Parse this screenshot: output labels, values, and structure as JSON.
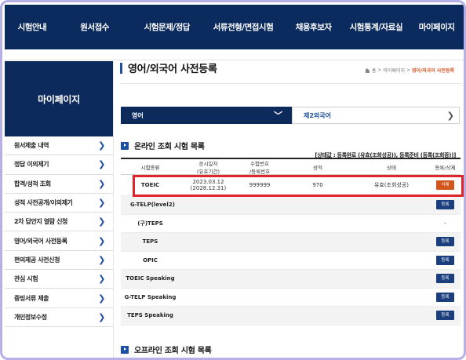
{
  "topnav": {
    "items": [
      "시험안내",
      "원서접수",
      "시험문제/정답",
      "서류전형/면접시험",
      "채용후보자",
      "시험통계/자료실",
      "마이페이지"
    ]
  },
  "sidebar": {
    "banner": "마이페이지",
    "items": [
      {
        "label": "원서제출 내역"
      },
      {
        "label": "정답 이의제기"
      },
      {
        "label": "합격/성적 조회"
      },
      {
        "label": "성적 사전공개/이의제기"
      },
      {
        "label": "2차 답안지 열람 신청"
      },
      {
        "label": "영어/외국어 사전등록"
      },
      {
        "label": "편의제공 사전신청"
      },
      {
        "label": "관심 시험"
      },
      {
        "label": "증빙서류 제출"
      },
      {
        "label": "개인정보수정"
      }
    ]
  },
  "page": {
    "title": "영어/외국어 사전등록",
    "breadcrumb": {
      "home": "홈",
      "sep1": ">",
      "level1": "마이페이지",
      "sep2": ">",
      "current": "영어/외국어 사전등록"
    }
  },
  "tabs": {
    "active": "영어",
    "inactive": "제2외국어"
  },
  "online_section": {
    "title": "온라인 조회 시험 목록",
    "legend": "[상태값 : 등록완료 (유효(조회성공)), 등록준비 (등록(조회중))]",
    "headers": {
      "exam": "시험종류",
      "date_line1": "응시일자",
      "date_line2": "(유효기간)",
      "num_line1": "수험번호",
      "num_line2": "/등록번호",
      "score": "성적",
      "status": "상태",
      "action": "등록/삭제"
    },
    "rows": [
      {
        "exam": "TOEIC",
        "date": "2023.03.12",
        "valid": "(2028.12.31)",
        "number": "999999",
        "score": "970",
        "status": "유효(조회성공)",
        "action": "삭제"
      },
      {
        "exam": "G-TELP(level2)",
        "date": "",
        "valid": "",
        "number": "",
        "score": "",
        "status": "",
        "action": "등록"
      },
      {
        "exam": "(구)TEPS",
        "date": "",
        "valid": "",
        "number": "",
        "score": "",
        "status": "",
        "action": "-"
      },
      {
        "exam": "TEPS",
        "date": "",
        "valid": "",
        "number": "",
        "score": "",
        "status": "",
        "action": "등록"
      },
      {
        "exam": "OPIC",
        "date": "",
        "valid": "",
        "number": "",
        "score": "",
        "status": "",
        "action": "등록"
      },
      {
        "exam": "TOEIC Speaking",
        "date": "",
        "valid": "",
        "number": "",
        "score": "",
        "status": "",
        "action": "등록"
      },
      {
        "exam": "G-TELP Speaking",
        "date": "",
        "valid": "",
        "number": "",
        "score": "",
        "status": "",
        "action": "등록"
      },
      {
        "exam": "TEPS Speaking",
        "date": "",
        "valid": "",
        "number": "",
        "score": "",
        "status": "",
        "action": "등록"
      }
    ]
  },
  "offline_section": {
    "title": "오프라인 조회 시험 목록"
  },
  "colors": {
    "nav_bg": "#0b2a5e",
    "accent": "#1c4fa0",
    "delete_btn": "#d0561c",
    "register_btn": "#1b3f7c",
    "highlight": "#e0242c"
  },
  "icons": [
    "home-icon",
    "chevron-right-icon",
    "chevron-down-icon",
    "section-bullet-icon"
  ]
}
